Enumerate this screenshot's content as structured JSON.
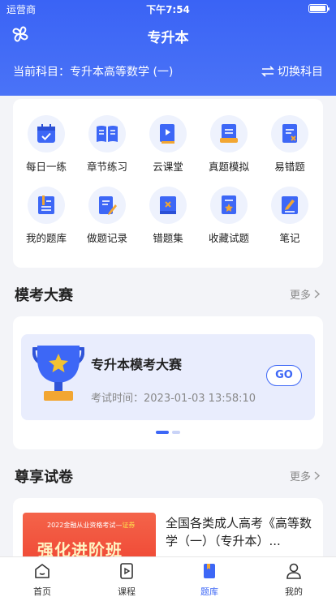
{
  "status": {
    "carrier": "运营商",
    "time": "下午7:54"
  },
  "nav": {
    "title": "专升本"
  },
  "subject": {
    "current": "当前科目：专升本高等数学 (一)",
    "switch_label": "切换科目"
  },
  "grid": [
    {
      "label": "每日一练",
      "icon": "calendar-check-icon"
    },
    {
      "label": "章节练习",
      "icon": "open-book-icon"
    },
    {
      "label": "云课堂",
      "icon": "video-play-icon"
    },
    {
      "label": "真题模拟",
      "icon": "exam-paper-icon"
    },
    {
      "label": "易错题",
      "icon": "error-doc-icon"
    },
    {
      "label": "我的题库",
      "icon": "question-bank-icon"
    },
    {
      "label": "做题记录",
      "icon": "edit-record-icon"
    },
    {
      "label": "错题集",
      "icon": "wrong-set-icon"
    },
    {
      "label": "收藏试题",
      "icon": "star-doc-icon"
    },
    {
      "label": "笔记",
      "icon": "note-pen-icon"
    }
  ],
  "contest": {
    "section_title": "模考大赛",
    "more_label": "更多",
    "title": "专升本模考大赛",
    "time": "考试时间：2023-01-03 13:58:10",
    "go_label": "GO"
  },
  "papers": {
    "section_title": "尊享试卷",
    "more_label": "更多",
    "thumb_top": "2022金融从业资格考试—",
    "thumb_top_highlight": "证券",
    "thumb_main": "强化进阶班",
    "title": "全国各类成人高考《高等数学（一）（专升本）..."
  },
  "tabbar": [
    {
      "label": "首页",
      "icon": "home-icon"
    },
    {
      "label": "课程",
      "icon": "course-icon"
    },
    {
      "label": "题库",
      "icon": "question-bank-tab-icon"
    },
    {
      "label": "我的",
      "icon": "profile-icon"
    }
  ],
  "colors": {
    "primary": "#3d67f6",
    "header_bg": "#4169f6",
    "page_bg": "#f3f4f8",
    "inactive_dot": "#c9d3f7"
  }
}
